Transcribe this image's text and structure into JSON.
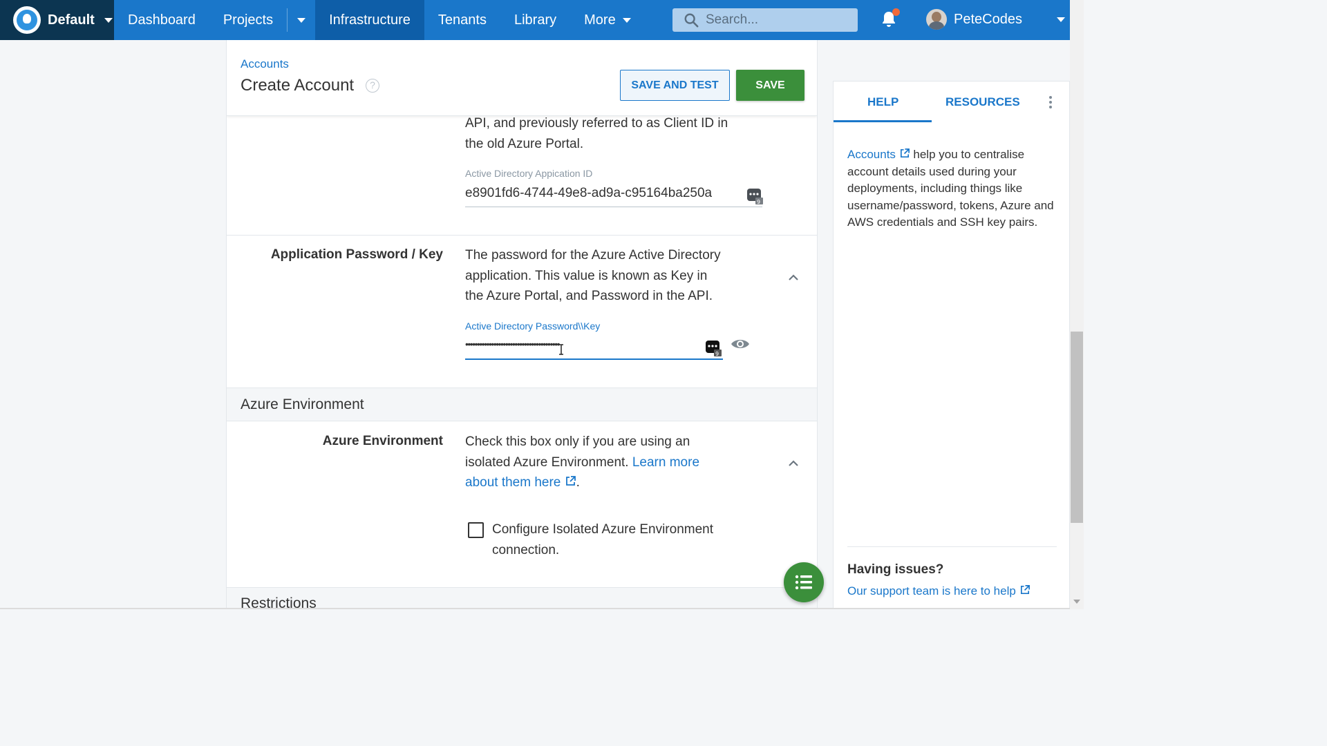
{
  "nav": {
    "space": "Default",
    "items": [
      "Dashboard",
      "Projects",
      "Infrastructure",
      "Tenants",
      "Library",
      "More"
    ],
    "active": "Infrastructure",
    "search_placeholder": "Search...",
    "user": "PeteCodes"
  },
  "page": {
    "breadcrumb": "Accounts",
    "title": "Create Account",
    "save_and_test": "SAVE AND TEST",
    "save": "SAVE"
  },
  "app_id_section": {
    "desc_line1": "API, and previously referred to as Client ID in",
    "desc_line2": "the old Azure Portal.",
    "field_label": "Active Directory Appication ID",
    "field_value": "e8901fd6-4744-49e8-ad9a-c95164ba250a"
  },
  "password_section": {
    "title": "Application Password / Key",
    "desc_line1": "The password for the Azure Active Directory",
    "desc_line2": "application. This value is known as Key in",
    "desc_line3": "the Azure Portal, and Password in the API.",
    "field_label": "Active Directory Password\\\\Key",
    "field_value": "••••••••••••••••••••••••••••••••••••••••"
  },
  "azure_env_section": {
    "header": "Azure Environment",
    "title": "Azure Environment",
    "desc_line1": "Check this box only if you are using an",
    "desc_line2_prefix": "isolated Azure Environment. ",
    "link_part1": "Learn more",
    "link_part2": "about them here",
    "desc_suffix": ".",
    "checkbox_line1": "Configure Isolated Azure Environment",
    "checkbox_line2": "connection.",
    "checkbox_checked": false
  },
  "restrictions_header": "Restrictions",
  "side_panel": {
    "tabs": [
      "HELP",
      "RESOURCES"
    ],
    "active_tab": "HELP",
    "accounts_link": "Accounts",
    "help_text": " help you to centralise account details used during your deployments, including things like username/password, tokens, Azure and AWS credentials and SSH key pairs.",
    "issues_title": "Having issues?",
    "support_link": "Our support team is here to help"
  },
  "colors": {
    "brand_blue": "#1a77ca",
    "nav_dark": "#0c3551",
    "active_nav": "#0e5ea8",
    "save_green": "#3b8f3b",
    "notification": "#f16a3a"
  },
  "icons": [
    "search-icon",
    "bell-icon",
    "help-circle-icon",
    "password-manager-icon",
    "eye-icon",
    "chevron-up-icon",
    "external-link-icon",
    "kebab-menu-icon",
    "list-icon"
  ]
}
